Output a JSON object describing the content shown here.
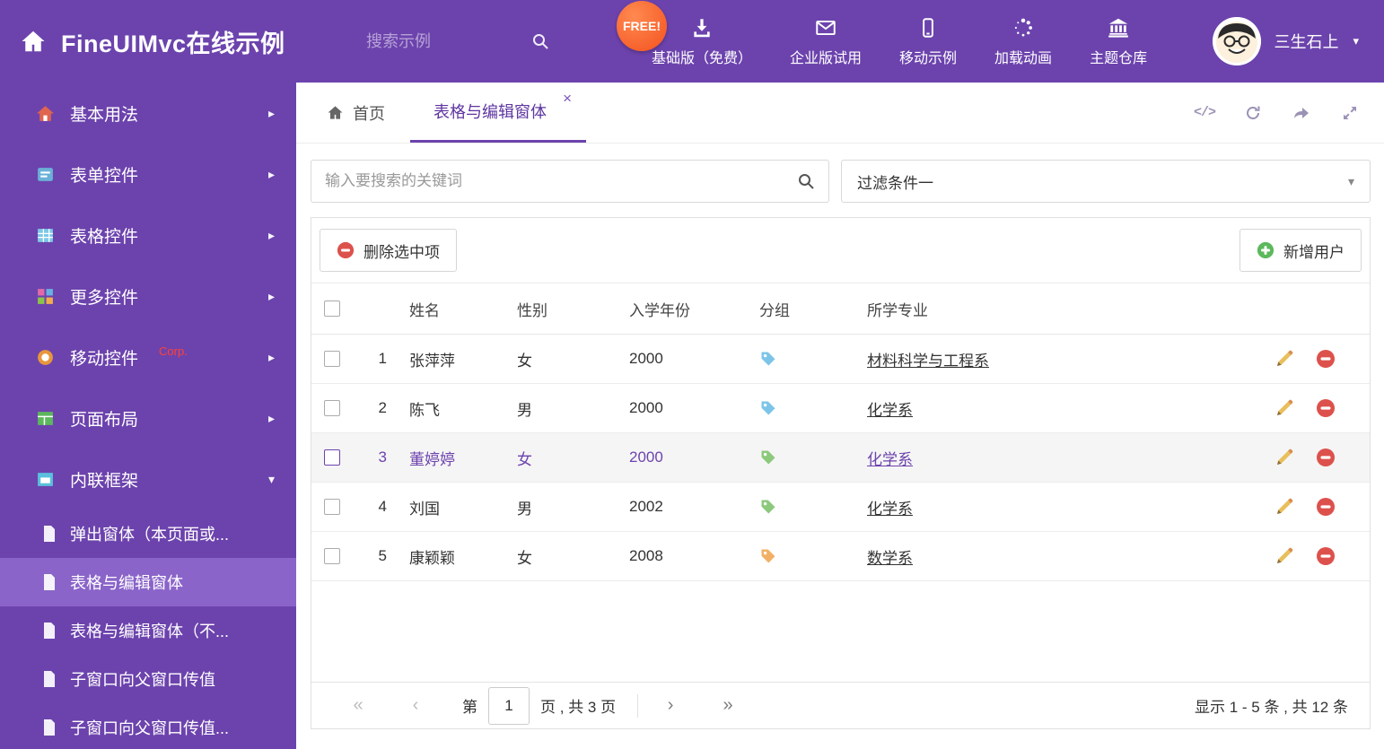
{
  "header": {
    "app_title": "FineUIMvc在线示例",
    "search_placeholder": "搜索示例",
    "free_badge": "FREE!",
    "nav_items": [
      {
        "label": "基础版（免费）",
        "icon": "download-icon"
      },
      {
        "label": "企业版试用",
        "icon": "envelope-icon"
      },
      {
        "label": "移动示例",
        "icon": "mobile-icon"
      },
      {
        "label": "加载动画",
        "icon": "spinner-icon"
      },
      {
        "label": "主题仓库",
        "icon": "bank-icon"
      }
    ],
    "user": {
      "name": "三生石上"
    }
  },
  "sidebar": {
    "items": [
      {
        "label": "基本用法"
      },
      {
        "label": "表单控件"
      },
      {
        "label": "表格控件"
      },
      {
        "label": "更多控件"
      },
      {
        "label": "移动控件",
        "badge": "Corp."
      },
      {
        "label": "页面布局"
      },
      {
        "label": "内联框架",
        "expanded": true
      }
    ],
    "subitems": [
      {
        "label": "弹出窗体（本页面或..."
      },
      {
        "label": "表格与编辑窗体",
        "active": true
      },
      {
        "label": "表格与编辑窗体（不..."
      },
      {
        "label": "子窗口向父窗口传值"
      },
      {
        "label": "子窗口向父窗口传值..."
      }
    ]
  },
  "tabs": {
    "home": "首页",
    "active": "表格与编辑窗体"
  },
  "filter_bar": {
    "search_placeholder": "输入要搜索的关键词",
    "filter_selected": "过滤条件一"
  },
  "grid": {
    "delete_button": "删除选中项",
    "add_button": "新增用户",
    "columns": {
      "name": "姓名",
      "gender": "性别",
      "year": "入学年份",
      "group": "分组",
      "major": "所学专业"
    },
    "rows": [
      {
        "index": "1",
        "name": "张萍萍",
        "gender": "女",
        "year": "2000",
        "tag_color": "#7cc5e8",
        "major": "材料科学与工程系",
        "selected": false
      },
      {
        "index": "2",
        "name": "陈飞",
        "gender": "男",
        "year": "2000",
        "tag_color": "#7cc5e8",
        "major": "化学系",
        "selected": false
      },
      {
        "index": "3",
        "name": "董婷婷",
        "gender": "女",
        "year": "2000",
        "tag_color": "#8cc97c",
        "major": "化学系",
        "selected": true
      },
      {
        "index": "4",
        "name": "刘国",
        "gender": "男",
        "year": "2002",
        "tag_color": "#8cc97c",
        "major": "化学系",
        "selected": false
      },
      {
        "index": "5",
        "name": "康颖颖",
        "gender": "女",
        "year": "2008",
        "tag_color": "#f2b066",
        "major": "数学系",
        "selected": false
      }
    ]
  },
  "pagination": {
    "first_icon": "«",
    "prev_icon": "‹",
    "next_icon": "›",
    "last_icon": "»",
    "page_label_before": "第",
    "current_page": "1",
    "page_label_after": "页 , 共 3 页",
    "summary": "显示 1 - 5 条 , 共 12 条"
  },
  "icons": {
    "chevron_right": "▸",
    "chevron_down": "▾",
    "caret_down": "▾",
    "close": "×",
    "code": "</>"
  },
  "colors": {
    "theme_purple": "#6c43ad",
    "selected_purple": "#8a64c9",
    "danger_red": "#dd514c",
    "success_green": "#5cb85c"
  }
}
